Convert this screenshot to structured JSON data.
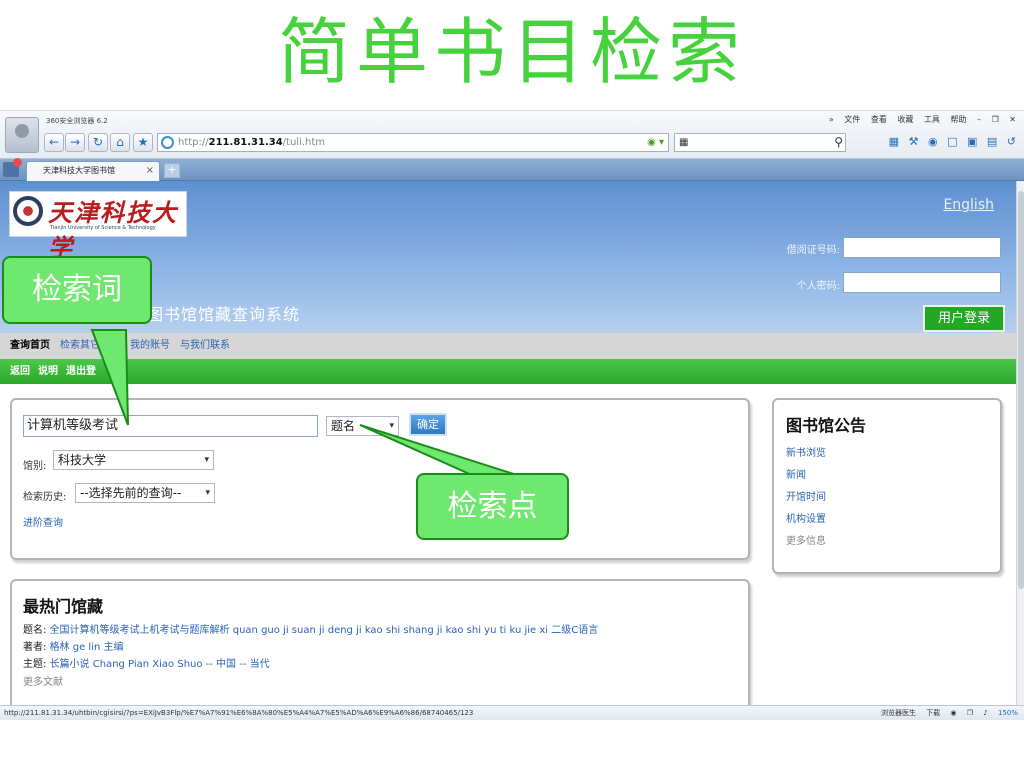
{
  "slide": {
    "title": "简单书目检索"
  },
  "browser": {
    "app_name": "360安全浏览器 6.2",
    "url_scheme": "http://",
    "url_host": "211.81.31.34",
    "url_path": "/tuli.htm",
    "menu": [
      "文件",
      "查看",
      "收藏",
      "工具",
      "帮助"
    ],
    "tab_title": "天津科技大学图书馆",
    "status_url": "http://211.81.31.34/uhtbin/cgisirsi/?ps=EXiJvB3Flp/%E7%A7%91%E6%8A%80%E5%A4%A7%E5%AD%A6%E9%A6%86/68740465/123",
    "status_items": [
      "浏览器医生",
      "下载"
    ],
    "zoom": "150%"
  },
  "header": {
    "logo_text": "天津科技大学",
    "logo_en": "Tianjin University of Science & Technology",
    "english_link": "English",
    "card_label": "借阅证号码:",
    "password_label": "个人密码:",
    "login_button": "用户登录",
    "system_title": "图书馆馆藏查询系统"
  },
  "nav": {
    "primary": [
      "查询首页",
      "检索其它",
      "馆",
      "我的账号",
      "与我们联系"
    ],
    "secondary": [
      "返回",
      "说明",
      "退出登"
    ]
  },
  "search": {
    "query": "计算机等级考试",
    "field": "题名",
    "ok_button": "确定",
    "library_label": "馆别:",
    "library_value": "科技大学",
    "history_label": "检索历史:",
    "history_value": "--选择先前的查询--",
    "advanced_link": "进阶查询"
  },
  "notice": {
    "title": "图书馆公告",
    "links": [
      "新书浏览",
      "新闻",
      "开馆时间",
      "机构设置"
    ],
    "more": "更多信息"
  },
  "popular": {
    "title": "最热门馆藏",
    "rows": [
      {
        "label": "题名:",
        "value": "全国计算机等级考试上机考试与题库解析 quan guo ji suan ji deng ji kao shi shang ji kao shi yu ti ku jie xi 二级C语言"
      },
      {
        "label": "著者:",
        "value": "格林 ge lin 主编"
      },
      {
        "label": "主题:",
        "value": "长篇小说 Chang Pian Xiao Shuo -- 中国 -- 当代"
      }
    ],
    "more": "更多文献"
  },
  "callouts": {
    "keyword": "检索词",
    "field": "检索点"
  },
  "colors": {
    "accent_green": "#46d23c",
    "header_blue": "#6f9ed8",
    "link_blue": "#2a63b4"
  }
}
